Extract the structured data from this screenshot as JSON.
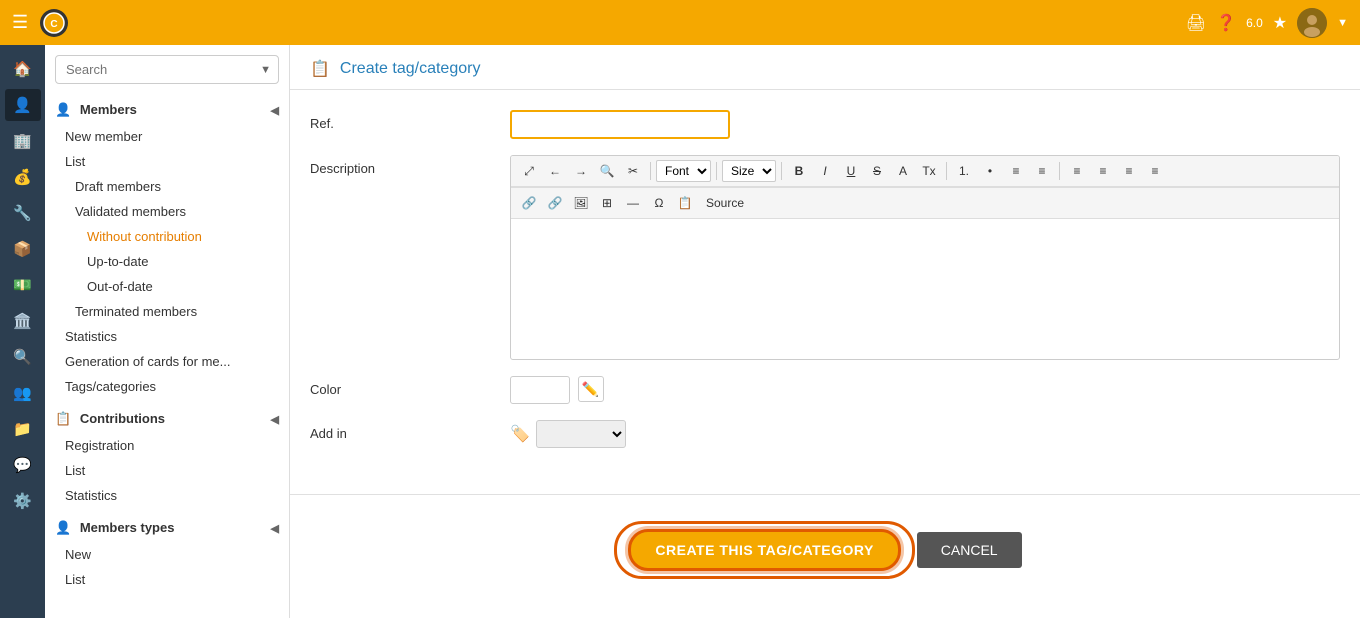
{
  "topbar": {
    "menu_icon": "☰",
    "version": "6.0",
    "print_icon": "🖨",
    "help_icon": "?",
    "star_icon": "★"
  },
  "icon_sidebar": {
    "items": [
      {
        "icon": "🏠",
        "name": "home"
      },
      {
        "icon": "👤",
        "name": "member"
      },
      {
        "icon": "🏢",
        "name": "building"
      },
      {
        "icon": "💰",
        "name": "money"
      },
      {
        "icon": "🔧",
        "name": "tools"
      },
      {
        "icon": "📦",
        "name": "package"
      },
      {
        "icon": "💵",
        "name": "payments"
      },
      {
        "icon": "🏛️",
        "name": "archive"
      },
      {
        "icon": "🔍",
        "name": "search"
      },
      {
        "icon": "👥",
        "name": "users"
      },
      {
        "icon": "📁",
        "name": "folder"
      },
      {
        "icon": "💬",
        "name": "chat"
      },
      {
        "icon": "⚙️",
        "name": "settings"
      }
    ]
  },
  "search": {
    "placeholder": "Search",
    "value": ""
  },
  "sidebar": {
    "members_section": {
      "label": "Members",
      "icon": "👤",
      "items": [
        {
          "label": "New member",
          "type": "item"
        },
        {
          "label": "List",
          "type": "item"
        },
        {
          "label": "Draft members",
          "type": "sub"
        },
        {
          "label": "Validated members",
          "type": "sub"
        },
        {
          "label": "Without contribution",
          "type": "deep",
          "active": true
        },
        {
          "label": "Up-to-date",
          "type": "deep"
        },
        {
          "label": "Out-of-date",
          "type": "deep"
        },
        {
          "label": "Terminated members",
          "type": "sub"
        },
        {
          "label": "Statistics",
          "type": "item"
        },
        {
          "label": "Generation of cards for me...",
          "type": "item"
        },
        {
          "label": "Tags/categories",
          "type": "item"
        }
      ]
    },
    "contributions_section": {
      "label": "Contributions",
      "icon": "📋",
      "items": [
        {
          "label": "Registration",
          "type": "item"
        },
        {
          "label": "List",
          "type": "item"
        },
        {
          "label": "Statistics",
          "type": "item"
        }
      ]
    },
    "members_types_section": {
      "label": "Members types",
      "icon": "👤",
      "items": [
        {
          "label": "New",
          "type": "item"
        },
        {
          "label": "List",
          "type": "item"
        }
      ]
    }
  },
  "page": {
    "title": "Create tag/category",
    "form": {
      "ref_label": "Ref.",
      "ref_placeholder": "",
      "ref_value": "",
      "description_label": "Description",
      "color_label": "Color",
      "add_in_label": "Add in",
      "toolbar": {
        "font_label": "Font",
        "size_label": "Size",
        "source_label": "Source",
        "buttons": [
          "⤢",
          "←",
          "→",
          "🔍",
          "✂",
          "B",
          "I",
          "U",
          "S",
          "A",
          "Tx",
          "1.",
          "•",
          "≡",
          "≡",
          "≡",
          "≡",
          "≡",
          "🔗",
          "🔗",
          "🖼",
          "⊞",
          "≡",
          "Ω",
          "📋",
          "Source"
        ]
      }
    },
    "buttons": {
      "create_label": "CREATE THIS TAG/CATEGORY",
      "cancel_label": "CANCEL"
    }
  }
}
